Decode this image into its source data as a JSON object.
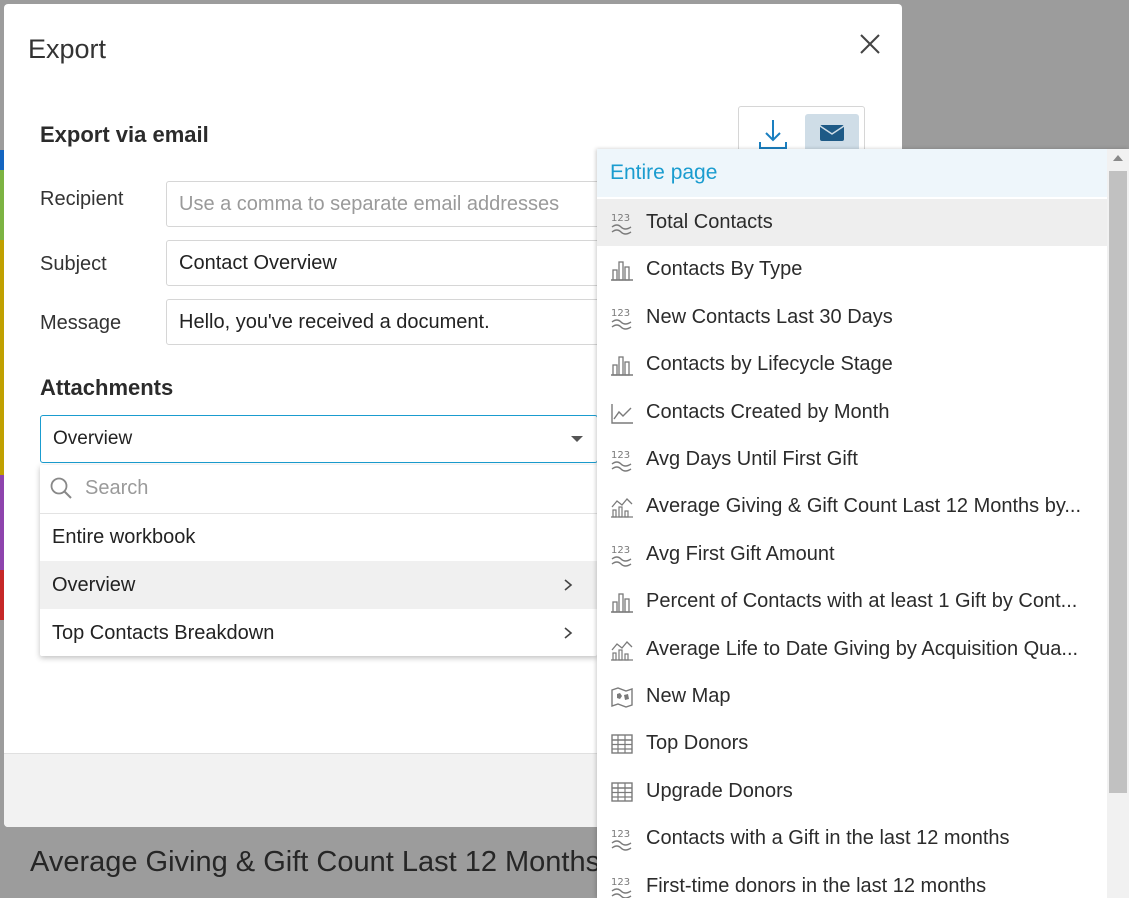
{
  "background": {
    "heading": "Average Giving & Gift Count Last 12 Months",
    "stripe_colors": [
      "#1565c0",
      "#7cb342",
      "#c0a000",
      "#8e44ad",
      "#c62828"
    ]
  },
  "modal": {
    "title": "Export",
    "section_title": "Export via email",
    "recipient_label": "Recipient",
    "recipient_placeholder": "Use a comma to separate email addresses",
    "subject_label": "Subject",
    "subject_value": "Contact Overview",
    "message_label": "Message",
    "message_value": "Hello, you've received a document.",
    "attachments_title": "Attachments",
    "attachment_selected": "Overview",
    "mode_active": "email"
  },
  "attach_menu": {
    "search_placeholder": "Search",
    "items": [
      {
        "label": "Entire workbook",
        "has_submenu": false
      },
      {
        "label": "Overview",
        "has_submenu": true,
        "active": true
      },
      {
        "label": "Top Contacts Breakdown",
        "has_submenu": true
      }
    ]
  },
  "sub_menu": {
    "header": "Entire page",
    "items": [
      {
        "label": "Total Contacts",
        "icon": "number-icon",
        "active": true
      },
      {
        "label": "Contacts By Type",
        "icon": "bar-chart-icon"
      },
      {
        "label": "New Contacts Last 30 Days",
        "icon": "number-icon"
      },
      {
        "label": "Contacts by Lifecycle Stage",
        "icon": "bar-chart-icon"
      },
      {
        "label": "Contacts Created by Month",
        "icon": "line-chart-icon"
      },
      {
        "label": "Avg Days Until First Gift",
        "icon": "number-icon"
      },
      {
        "label": "Average Giving & Gift Count Last 12 Months by...",
        "icon": "combo-chart-icon"
      },
      {
        "label": "Avg First Gift Amount",
        "icon": "number-icon"
      },
      {
        "label": "Percent of Contacts with at least 1 Gift by Cont...",
        "icon": "bar-chart-icon"
      },
      {
        "label": "Average Life to Date Giving by Acquisition Qua...",
        "icon": "combo-chart-icon"
      },
      {
        "label": "New Map",
        "icon": "map-icon"
      },
      {
        "label": "Top Donors",
        "icon": "table-icon"
      },
      {
        "label": "Upgrade Donors",
        "icon": "table-icon"
      },
      {
        "label": "Contacts with a Gift in the last 12 months",
        "icon": "number-icon"
      },
      {
        "label": "First-time donors in the last 12 months",
        "icon": "number-icon"
      }
    ]
  }
}
